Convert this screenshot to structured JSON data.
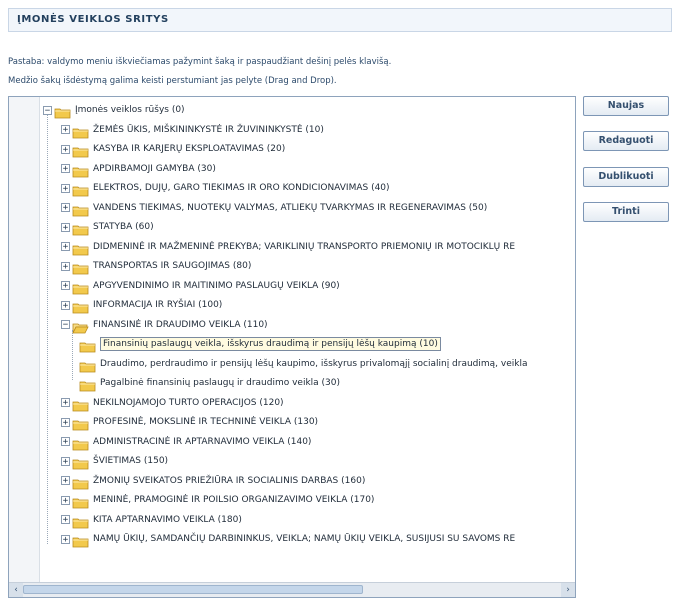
{
  "header": {
    "title": "ĮMONĖS VEIKLOS SRITYS"
  },
  "notes": [
    "Pastaba: valdymo meniu iškviečiamas pažymint šaką ir paspaudžiant dešinį pelės klavišą.",
    "Medžio šakų išdėstymą galima keisti perstumiant jas pelyte (Drag and Drop)."
  ],
  "tree": {
    "root": {
      "label": "Įmonės veiklos rūšys (0)",
      "toggle": "−"
    },
    "items": [
      {
        "label": "ŽEMĖS ŪKIS, MIŠKININKYSTĖ IR ŽUVININKYSTĖ (10)",
        "toggle": "+"
      },
      {
        "label": "KASYBA IR KARJERŲ EKSPLOATAVIMAS (20)",
        "toggle": "+"
      },
      {
        "label": "APDIRBAMOJI GAMYBA (30)",
        "toggle": "+"
      },
      {
        "label": "ELEKTROS, DUJŲ, GARO TIEKIMAS IR ORO KONDICIONAVIMAS (40)",
        "toggle": "+"
      },
      {
        "label": "VANDENS TIEKIMAS, NUOTEKŲ VALYMAS, ATLIEKŲ TVARKYMAS IR REGENERAVIMAS (50)",
        "toggle": "+"
      },
      {
        "label": "STATYBA (60)",
        "toggle": "+"
      },
      {
        "label": "DIDMENINĖ IR MAŽMENINĖ PREKYBA; VARIKLINIŲ TRANSPORTO PRIEMONIŲ IR MOTOCIKLŲ RE",
        "toggle": "+"
      },
      {
        "label": "TRANSPORTAS IR SAUGOJIMAS (80)",
        "toggle": "+"
      },
      {
        "label": "APGYVENDINIMO IR MAITINIMO PASLAUGŲ VEIKLA (90)",
        "toggle": "+"
      },
      {
        "label": "INFORMACIJA IR RYŠIAI (100)",
        "toggle": "+"
      },
      {
        "label": "FINANSINĖ IR DRAUDIMO VEIKLA (110)",
        "toggle": "−",
        "open": true
      },
      {
        "label": "Finansinių paslaugų veikla, išskyrus draudimą ir pensijų lėšų kaupimą (10)",
        "child": true,
        "selected": true
      },
      {
        "label": "Draudimo, perdraudimo ir pensijų lėšų kaupimo, išskyrus privalomąjį socialinį draudimą, veikla",
        "child": true
      },
      {
        "label": "Pagalbinė finansinių paslaugų ir draudimo veikla (30)",
        "child": true
      },
      {
        "label": "NEKILNOJAMOJO TURTO OPERACIJOS (120)",
        "toggle": "+"
      },
      {
        "label": "PROFESINĖ, MOKSLINĖ IR TECHNINĖ VEIKLA (130)",
        "toggle": "+"
      },
      {
        "label": "ADMINISTRACINĖ IR APTARNAVIMO VEIKLA (140)",
        "toggle": "+"
      },
      {
        "label": "ŠVIETIMAS (150)",
        "toggle": "+"
      },
      {
        "label": "ŽMONIŲ SVEIKATOS PRIEŽIŪRA IR SOCIALINIS DARBAS (160)",
        "toggle": "+"
      },
      {
        "label": "MENINĖ, PRAMOGINĖ IR POILSIO ORGANIZAVIMO VEIKLA (170)",
        "toggle": "+"
      },
      {
        "label": "KITA APTARNAVIMO VEIKLA (180)",
        "toggle": "+"
      },
      {
        "label": "NAMŲ ŪKIŲ, SAMDANČIŲ DARBININKUS, VEIKLA; NAMŲ ŪKIŲ VEIKLA, SUSIJUSI SU SAVOMS RE",
        "toggle": "+"
      }
    ],
    "scroll": {
      "left_icon": "‹",
      "right_icon": "›",
      "thumb_grip": "III"
    }
  },
  "buttons": {
    "new": "Naujas",
    "edit": "Redaguoti",
    "duplicate": "Dublikuoti",
    "delete": "Trinti"
  },
  "colors": {
    "folder": "#f2c94c",
    "folder_edge": "#b98a1c",
    "border": "#8ea3bc",
    "accent": "#23405e"
  }
}
